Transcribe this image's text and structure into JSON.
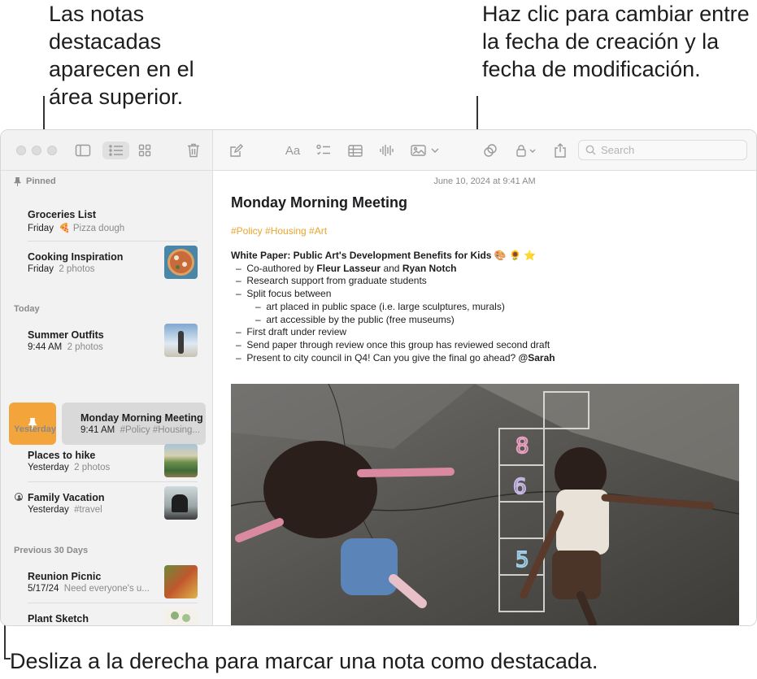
{
  "callouts": {
    "pinned_area": "Las notas destacadas aparecen en el área superior.",
    "date_toggle": "Haz clic para cambiar entre la fecha de creación y la fecha de modificación.",
    "swipe": "Desliza a la derecha para marcar una nota como destacada."
  },
  "toolbar": {
    "search_placeholder": "Search",
    "font_label": "Aa",
    "icons": [
      "sidebar-icon",
      "list-view-icon",
      "gallery-view-icon",
      "trash-icon",
      "compose-icon",
      "format-icon",
      "checklist-icon",
      "table-icon",
      "audio-icon",
      "media-icon",
      "collaborate-icon",
      "lock-icon",
      "share-icon",
      "search-icon"
    ]
  },
  "sidebar": {
    "pinned_label": "Pinned",
    "sections": {
      "today": "Today",
      "yesterday": "Yesterday",
      "previous": "Previous 30 Days"
    },
    "notes": [
      {
        "title": "Groceries List",
        "date": "Friday",
        "preview": "🍕 Pizza dough"
      },
      {
        "title": "Cooking Inspiration",
        "date": "Friday",
        "preview": "2 photos"
      },
      {
        "title": "Summer Outfits",
        "date": "9:44 AM",
        "preview": "2 photos"
      },
      {
        "title": "Monday Morning Meeting",
        "date": "9:41 AM",
        "preview": "#Policy #Housing..."
      },
      {
        "title": "Places to hike",
        "date": "Yesterday",
        "preview": "2 photos"
      },
      {
        "title": "Family Vacation",
        "date": "Yesterday",
        "preview": "#travel"
      },
      {
        "title": "Reunion Picnic",
        "date": "5/17/24",
        "preview": "Need everyone's u..."
      },
      {
        "title": "Plant Sketch",
        "date": "",
        "preview": ""
      }
    ]
  },
  "note": {
    "date": "June 10, 2024 at 9:41 AM",
    "title": "Monday Morning Meeting",
    "tags": "#Policy #Housing #Art",
    "heading": "White Paper: Public Art's Development Benefits for Kids 🎨 🌻 ⭐",
    "b1_pre": "Co-authored by ",
    "b1_name1": "Fleur Lasseur",
    "b1_mid": " and ",
    "b1_name2": "Ryan Notch",
    "b2": "Research support from graduate students",
    "b3": "Split focus between",
    "b3a": "art placed in public space (i.e. large sculptures, murals)",
    "b3b": "art accessible by the public (free museums)",
    "b4": "First draft under review",
    "b5": "Send paper through review once this group has reviewed second draft",
    "b6_pre": "Present to city council in Q4! Can you give the final go ahead? ",
    "b6_mention": "@Sarah"
  },
  "colors": {
    "accent": "#e7a531",
    "pin_button": "#f3a43a"
  }
}
